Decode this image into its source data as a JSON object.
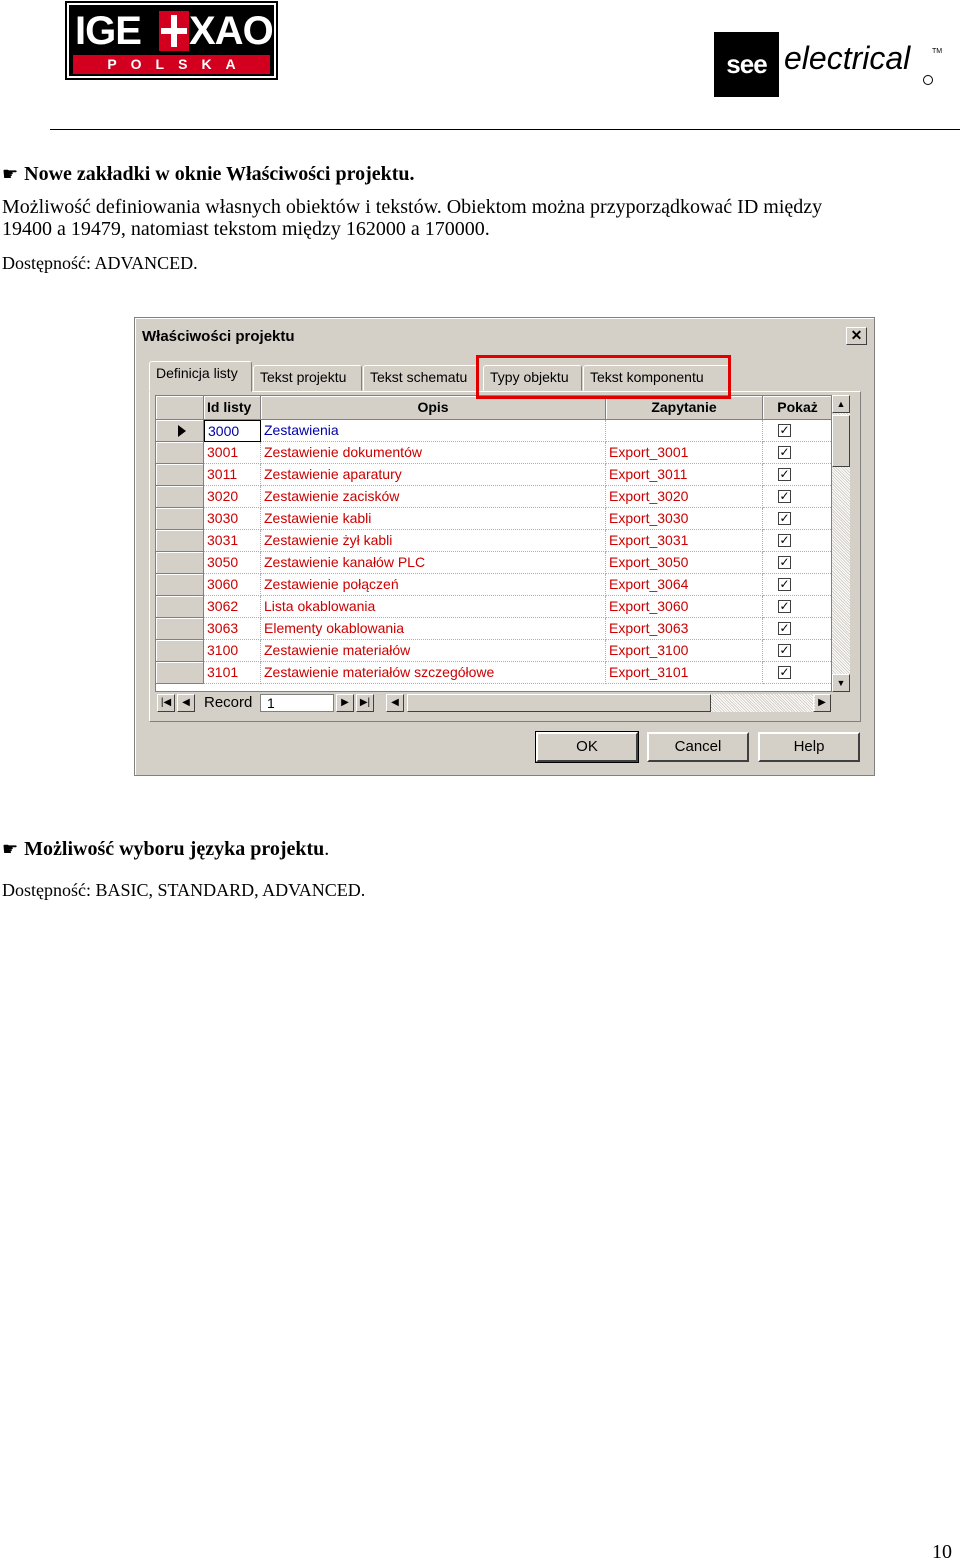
{
  "header": {
    "ige_logo_main": "IGE",
    "ige_logo_main2": "XAO",
    "ige_logo_sub": "POLSKA",
    "see_logo_box": "see",
    "see_logo_text": "electrical",
    "see_logo_tm": "TM"
  },
  "section1": {
    "heading": "Nowe zakładki w oknie Właściwości projektu.",
    "line1": "Możliwość definiowania własnych obiektów i tekstów. Obiektom można przyporządkować ID między",
    "line2": "19400 a 19479, natomiast tekstom między 162000 a 170000.",
    "availability": "Dostępność: ADVANCED."
  },
  "dialog": {
    "title": "Właściwości projektu",
    "close_glyph": "✕",
    "tabs": [
      {
        "label": "Definicja listy",
        "active": true
      },
      {
        "label": "Tekst projektu",
        "active": false
      },
      {
        "label": "Tekst schematu",
        "active": false
      },
      {
        "label": "Typy objektu",
        "active": false
      },
      {
        "label": "Tekst komponentu",
        "active": false
      }
    ],
    "highlight_color": "#e00000",
    "columns": [
      "Id listy",
      "Opis",
      "Zapytanie",
      "Pokaż"
    ],
    "rows": [
      {
        "id": "3000",
        "opis": "Zestawienia",
        "zapytanie": "",
        "show": true,
        "current": true
      },
      {
        "id": "3001",
        "opis": "Zestawienie dokumentów",
        "zapytanie": "Export_3001",
        "show": true
      },
      {
        "id": "3011",
        "opis": "Zestawienie aparatury",
        "zapytanie": "Export_3011",
        "show": true
      },
      {
        "id": "3020",
        "opis": "Zestawienie zacisków",
        "zapytanie": "Export_3020",
        "show": true
      },
      {
        "id": "3030",
        "opis": "Zestawienie kabli",
        "zapytanie": "Export_3030",
        "show": true
      },
      {
        "id": "3031",
        "opis": "Zestawienie żył kabli",
        "zapytanie": "Export_3031",
        "show": true
      },
      {
        "id": "3050",
        "opis": "Zestawienie kanałów PLC",
        "zapytanie": "Export_3050",
        "show": true
      },
      {
        "id": "3060",
        "opis": "Zestawienie połączeń",
        "zapytanie": "Export_3064",
        "show": true
      },
      {
        "id": "3062",
        "opis": "Lista okablowania",
        "zapytanie": "Export_3060",
        "show": true
      },
      {
        "id": "3063",
        "opis": "Elementy okablowania",
        "zapytanie": "Export_3063",
        "show": true
      },
      {
        "id": "3100",
        "opis": "Zestawienie materiałów",
        "zapytanie": "Export_3100",
        "show": true
      },
      {
        "id": "3101",
        "opis": "Zestawienie materiałów szczegółowe",
        "zapytanie": "Export_3101",
        "show": true
      }
    ],
    "nav": {
      "record_label": "Record",
      "record_value": "1",
      "first": "|◀",
      "prev": "◀",
      "next": "▶",
      "last": "▶|",
      "left": "◀",
      "right": "▶"
    },
    "scroll": {
      "up": "▲",
      "down": "▼"
    },
    "buttons": {
      "ok": "OK",
      "cancel": "Cancel",
      "help": "Help"
    },
    "check_glyph": "✓"
  },
  "section2": {
    "heading": "Możliwość wyboru języka projektu",
    "heading_end": ".",
    "availability": "Dostępność: BASIC, STANDARD, ADVANCED."
  },
  "page_number": "10",
  "bullet_glyph": "☛"
}
